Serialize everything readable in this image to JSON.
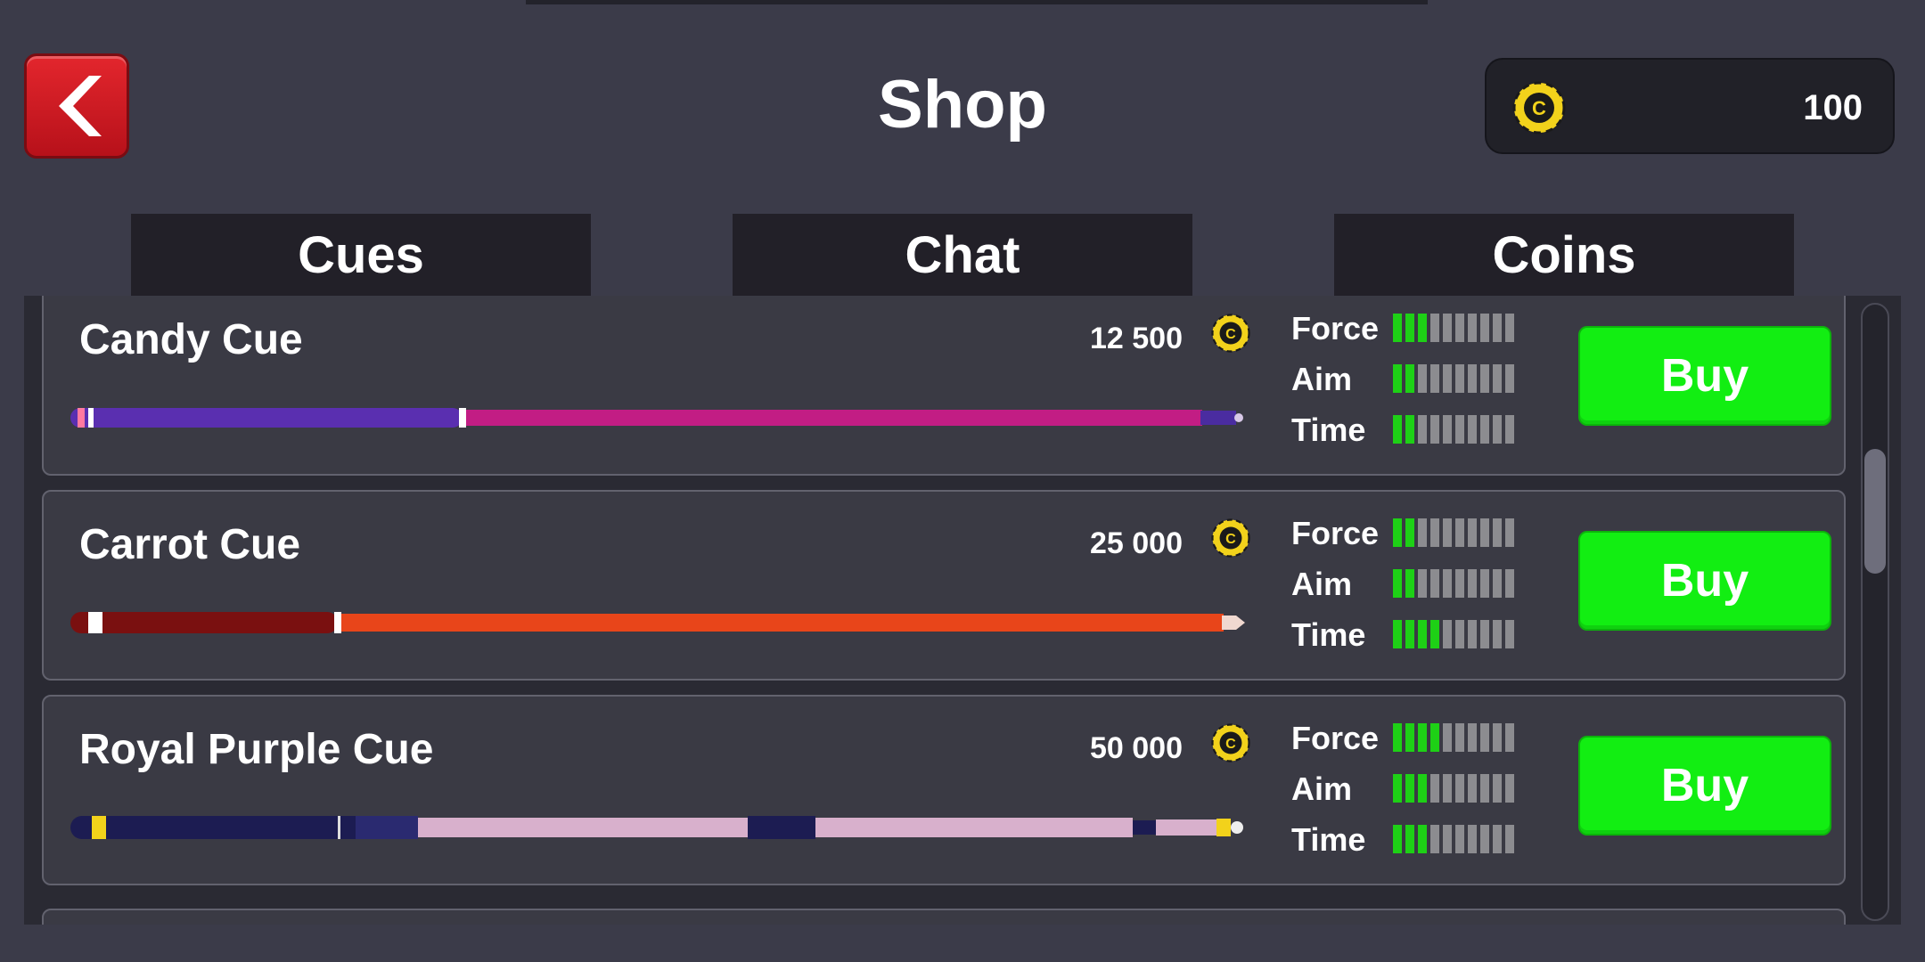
{
  "header": {
    "title": "Shop",
    "coin_balance": "100",
    "back_icon": "chevron-left-icon"
  },
  "tabs": [
    {
      "label": "Cues"
    },
    {
      "label": "Chat"
    },
    {
      "label": "Coins"
    }
  ],
  "stat_labels": {
    "force": "Force",
    "aim": "Aim",
    "time": "Time"
  },
  "cues": [
    {
      "name": "Candy Cue",
      "price": "12 500",
      "force": 3,
      "aim": 2,
      "time": 2,
      "buy_label": "Buy"
    },
    {
      "name": "Carrot Cue",
      "price": "25 000",
      "force": 2,
      "aim": 2,
      "time": 4,
      "buy_label": "Buy"
    },
    {
      "name": "Royal Purple Cue",
      "price": "50 000",
      "force": 4,
      "aim": 3,
      "time": 3,
      "buy_label": "Buy"
    }
  ],
  "stat_max": 10,
  "colors": {
    "background": "#3b3b49",
    "buy_green": "#12ee12",
    "stat_on": "#1ed016",
    "back_red": "#d41c24",
    "coin_yellow": "#f2d21b"
  }
}
